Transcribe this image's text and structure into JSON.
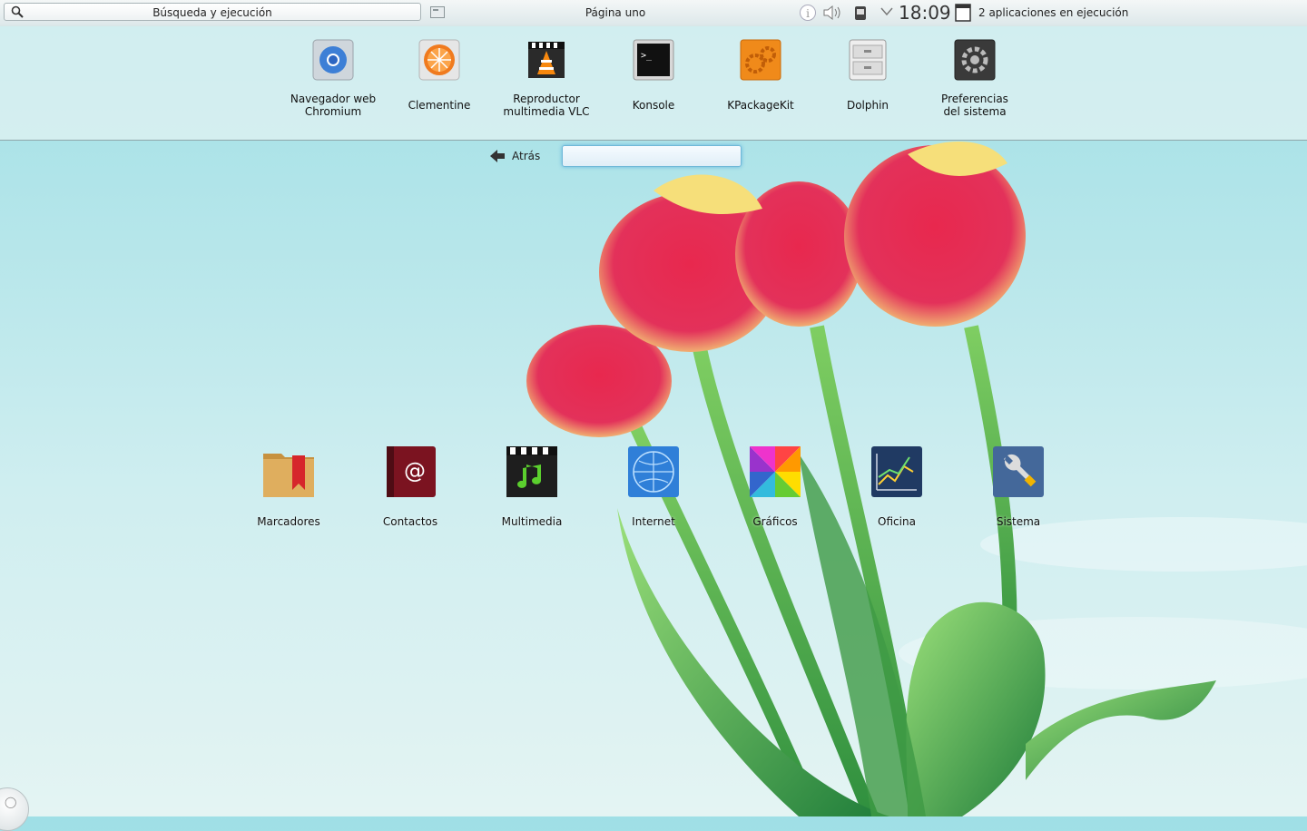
{
  "panel": {
    "search_label": "Búsqueda y ejecución",
    "page_title": "Página uno",
    "clock": "18:09",
    "running_apps": "2 aplicaciones en ejecución"
  },
  "favorites": [
    {
      "label": "Navegador web\nChromium",
      "icon": "chromium-icon"
    },
    {
      "label": "Clementine",
      "icon": "clementine-icon"
    },
    {
      "label": "Reproductor\nmultimedia VLC",
      "icon": "vlc-icon"
    },
    {
      "label": "Konsole",
      "icon": "konsole-icon"
    },
    {
      "label": "KPackageKit",
      "icon": "kpackagekit-icon"
    },
    {
      "label": "Dolphin",
      "icon": "dolphin-icon"
    },
    {
      "label": "Preferencias\ndel sistema",
      "icon": "system-settings-icon"
    }
  ],
  "navigation": {
    "back_label": "Atrás",
    "filter_value": ""
  },
  "categories": [
    {
      "label": "Marcadores",
      "icon": "bookmarks-folder-icon"
    },
    {
      "label": "Contactos",
      "icon": "address-book-icon"
    },
    {
      "label": "Multimedia",
      "icon": "multimedia-clapper-icon"
    },
    {
      "label": "Internet",
      "icon": "internet-globe-icon"
    },
    {
      "label": "Gráficos",
      "icon": "graphics-color-wheel-icon"
    },
    {
      "label": "Oficina",
      "icon": "office-chart-icon"
    },
    {
      "label": "Sistema",
      "icon": "system-wrench-icon"
    }
  ],
  "colors": {
    "sky": "#b6e6ea",
    "tulip_red": "#e8284e",
    "tulip_yellow": "#f6df7a",
    "stem_green": "#4fb14a",
    "focus_blue": "#6fb8d8"
  }
}
